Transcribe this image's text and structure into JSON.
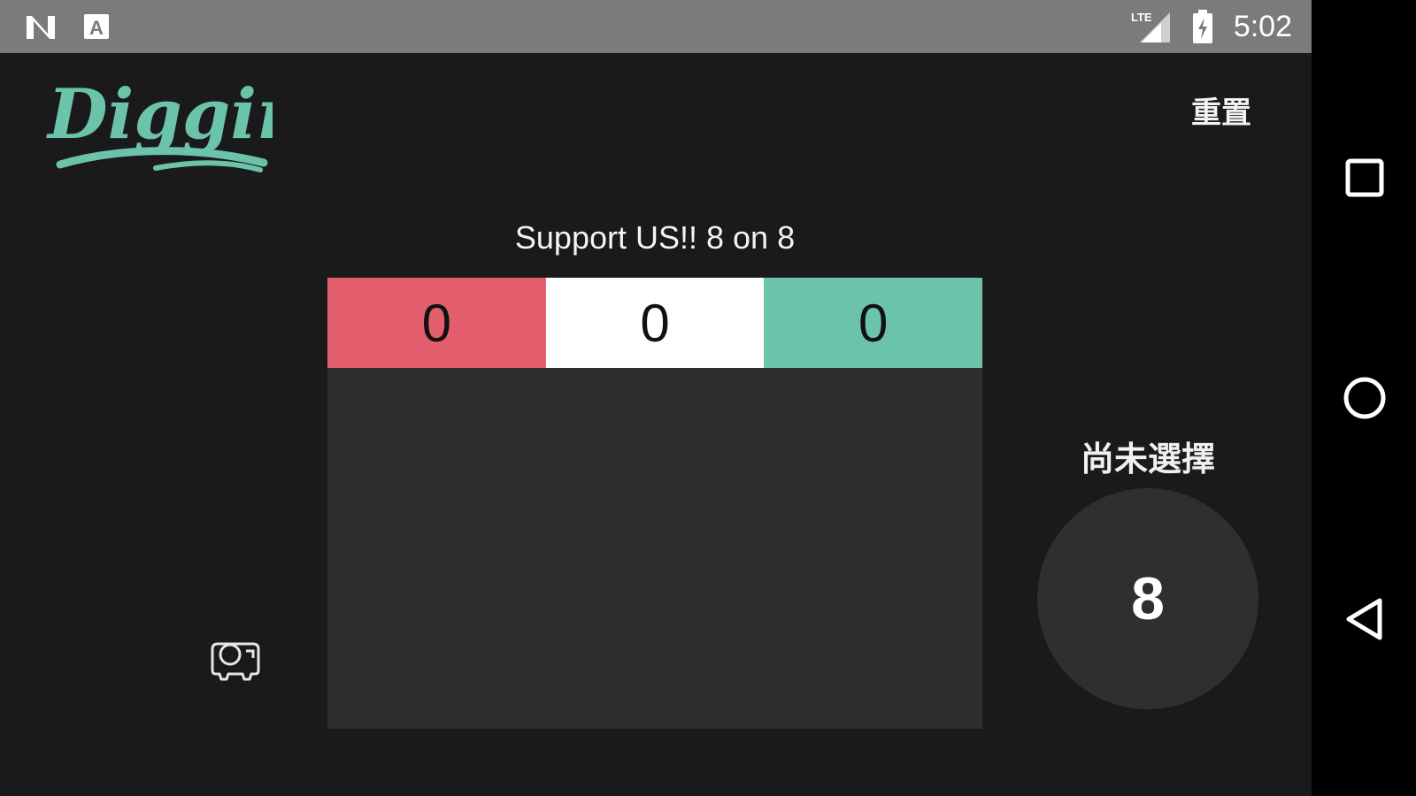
{
  "status_bar": {
    "time": "5:02",
    "left_icons": [
      "n-notification-icon",
      "a-notification-icon"
    ],
    "right_icons": [
      "lte-signal-icon",
      "battery-charging-icon"
    ]
  },
  "nav_bar": {
    "icons": [
      "recents-square-icon",
      "home-circle-icon",
      "back-triangle-icon"
    ]
  },
  "app": {
    "logo_text": "Diggin'",
    "reset_label": "重置",
    "title": "Support US!! 8 on 8",
    "scores": [
      {
        "value": "0",
        "color": "#e35f6d"
      },
      {
        "value": "0",
        "color": "#ffffff"
      },
      {
        "value": "0",
        "color": "#6ac3aa"
      }
    ],
    "selection_label": "尚未選擇",
    "count": "8"
  },
  "colors": {
    "background": "#1a1a1a",
    "board": "#2e2e2e",
    "accent_green": "#6ac3aa",
    "accent_red": "#e35f6d"
  }
}
